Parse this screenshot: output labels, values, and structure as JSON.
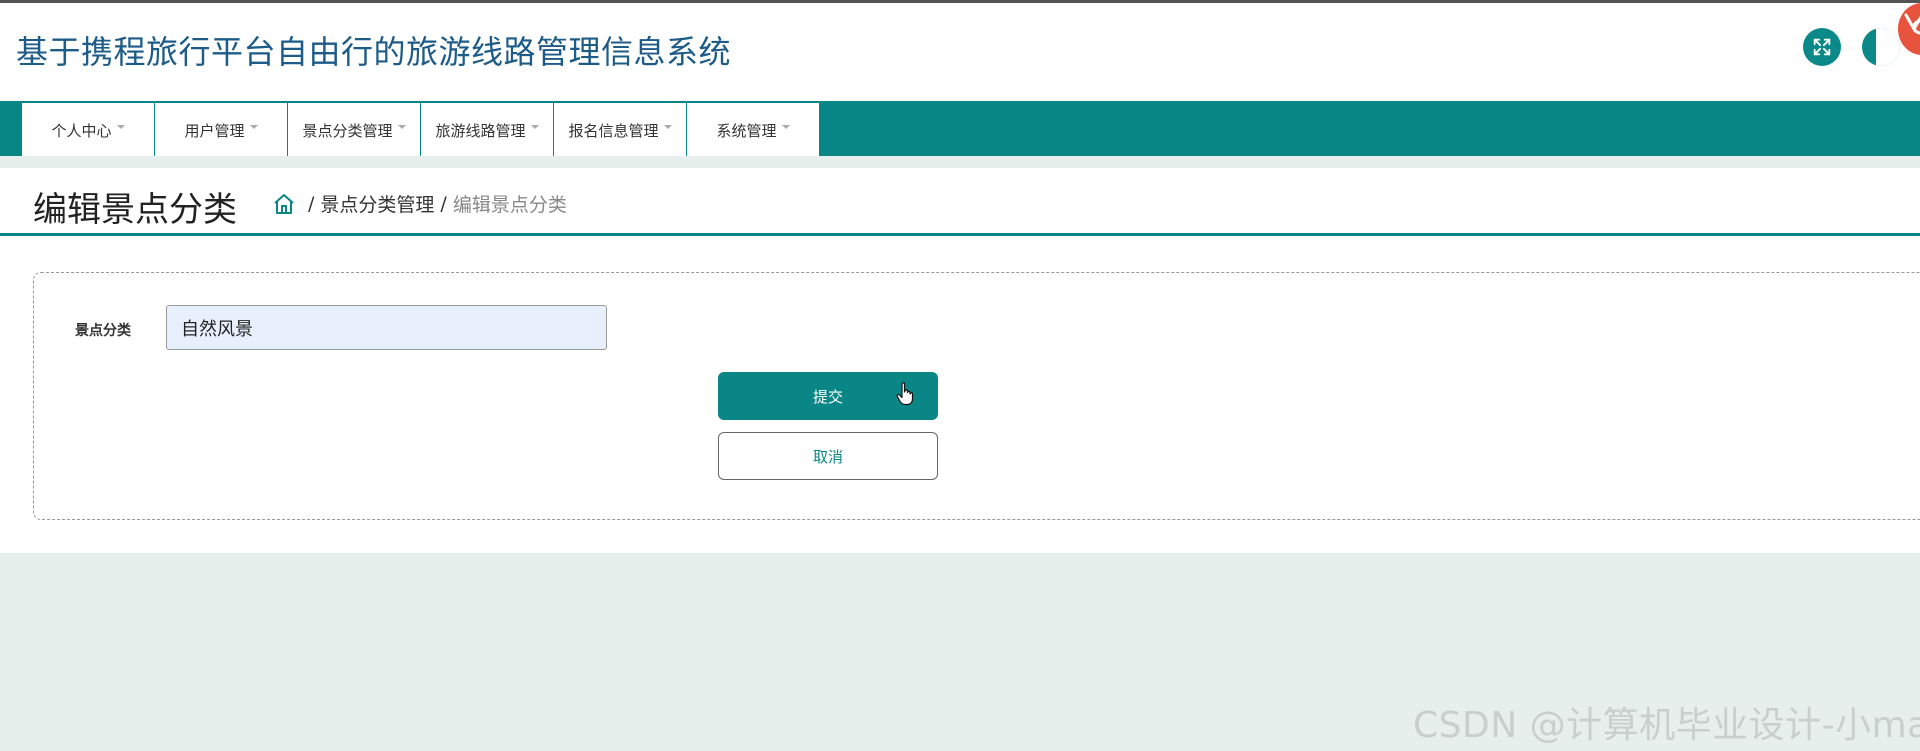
{
  "app": {
    "title": "基于携程旅行平台自由行的旅游线路管理信息系统"
  },
  "header": {
    "fullscreen_icon": "expand-icon",
    "second_icon": "circle-button-icon",
    "avatar_icon": "avatar-icon"
  },
  "nav": {
    "items": [
      {
        "label": "个人中心"
      },
      {
        "label": "用户管理"
      },
      {
        "label": "景点分类管理"
      },
      {
        "label": "旅游线路管理"
      },
      {
        "label": "报名信息管理"
      },
      {
        "label": "系统管理"
      }
    ]
  },
  "page": {
    "title": "编辑景点分类",
    "breadcrumb": {
      "home_icon": "home-icon",
      "sep": "/",
      "parent": "景点分类管理",
      "current": "编辑景点分类"
    }
  },
  "form": {
    "field_label": "景点分类",
    "field_value": "自然风景",
    "submit_label": "提交",
    "cancel_label": "取消"
  },
  "watermark": "CSDN @计算机毕业设计-小ma",
  "colors": {
    "primary": "#0b8686",
    "title": "#1d5b88",
    "background": "#e6efec",
    "input_bg": "#e8f0fe"
  }
}
